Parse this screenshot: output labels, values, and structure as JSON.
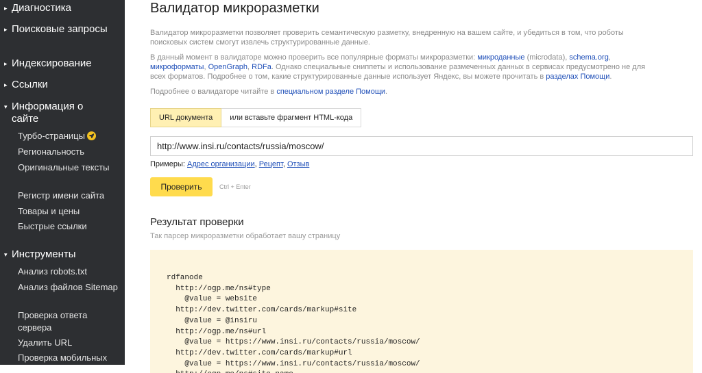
{
  "sidebar": {
    "sections": [
      {
        "label": "Диагностика",
        "expanded": false
      },
      {
        "label": "Поисковые запросы",
        "expanded": false
      },
      {
        "label": "Индексирование",
        "expanded": false
      },
      {
        "label": "Ссылки",
        "expanded": false
      },
      {
        "label": "Информация о сайте",
        "expanded": true
      },
      {
        "label": "Инструменты",
        "expanded": true
      }
    ],
    "arrow_collapsed": "▸",
    "arrow_expanded": "▾",
    "site_info_items": [
      "Турбо-страницы",
      "Региональность",
      "Оригинальные тексты",
      "Регистр имени сайта",
      "Товары и цены",
      "Быстрые ссылки"
    ],
    "tools_items": [
      "Анализ robots.txt",
      "Анализ файлов Sitemap",
      "Проверка ответа сервера",
      "Удалить URL",
      "Проверка мобильных"
    ]
  },
  "main": {
    "title": "Валидатор микроразметки",
    "intro": "Валидатор микроразметки позволяет проверить семантическую разметку, внедренную на вашем сайте, и убедиться в том, что роботы поисковых систем смогут извлечь структурированные данные.",
    "formats": {
      "t1": "В данный момент в валидаторе можно проверить все популярные форматы микроразметки: ",
      "l1": "микроданные",
      "t2": " (microdata), ",
      "l2": "schema.org",
      "t3": ", ",
      "l3": "микроформаты",
      "t4": ", ",
      "l4": "OpenGraph",
      "t5": ", ",
      "l5": "RDFa",
      "t6": ". Однако специальные сниппеты и использование размеченных данных в сервисах предусмотрено не для всех форматов. Подробнее о том, какие структурированные данные использует Яндекс, вы можете прочитать в ",
      "l6": "разделах Помощи",
      "t7": "."
    },
    "more": {
      "t1": "Подробнее о валидаторе читайте в ",
      "l1": "специальном разделе Помощи",
      "t2": "."
    },
    "tabs": [
      "URL документа",
      "или вставьте фрагмент HTML-кода"
    ],
    "url_value": "http://www.insi.ru/contacts/russia/moscow/",
    "examples": {
      "label": "Примеры: ",
      "items": [
        "Адрес организации",
        "Рецепт",
        "Отзыв"
      ],
      "sep": ", "
    },
    "check_button": "Проверить",
    "shortcut": "Ctrl + Enter",
    "result_title": "Результат проверки",
    "result_subtitle": "Так парсер микроразметки обработает вашу страницу",
    "code": "rdfanode\n  http://ogp.me/ns#type\n    @value = website\n  http://dev.twitter.com/cards/markup#site\n    @value = @insiru\n  http://ogp.me/ns#url\n    @value = https://www.insi.ru/contacts/russia/moscow/\n  http://dev.twitter.com/cards/markup#url\n    @value = https://www.insi.ru/contacts/russia/moscow/\n  http://ogp.me/ns#site_name"
  },
  "colors": {
    "sidebar_bg": "#2d2f32",
    "accent_yellow": "#ffdb4d",
    "link": "#1f4fb8",
    "code_bg": "#fdf5de"
  }
}
